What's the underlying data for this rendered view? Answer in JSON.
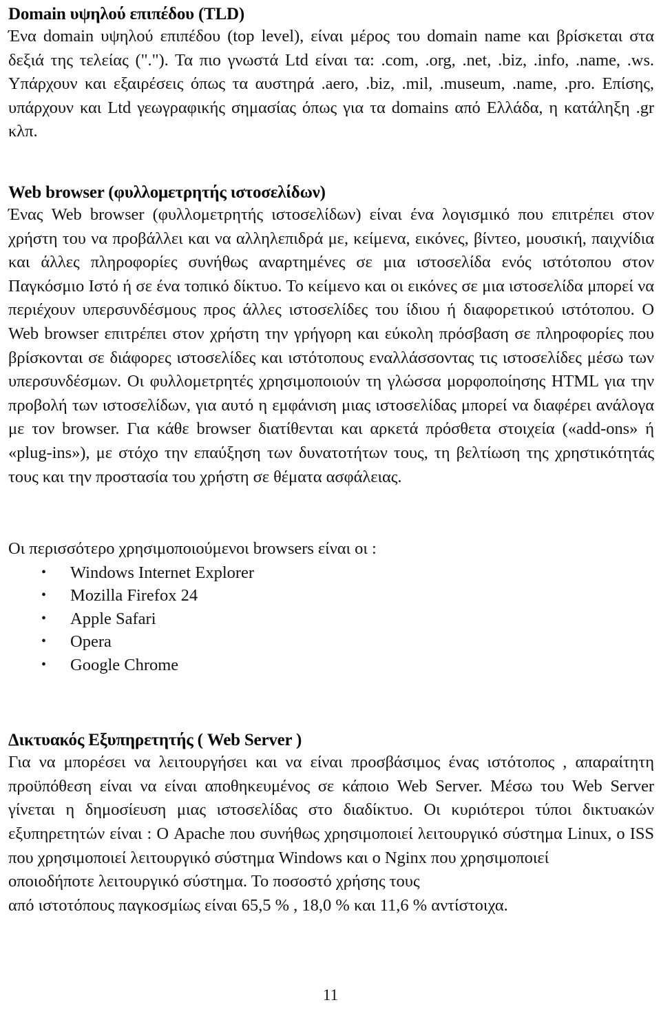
{
  "page": {
    "number": "11",
    "language": "el"
  },
  "sections": {
    "tld": {
      "heading": "Domain υψηλού επιπέδου (TLD)",
      "paragraph": "Ένα domain υψηλού επιπέδου (top level), είναι μέρος του domain name και βρίσκεται στα δεξιά της τελείας (\".\"). Τα πιο γνωστά Ltd είναι τα: .com, .org, .net, .biz, .info, .name, .ws. Υπάρχουν και εξαιρέσεις όπως τα αυστηρά .aero, .biz, .mil, .museum, .name, .pro. Επίσης, υπάρχουν και Ltd γεωγραφικής σημασίας όπως για τα domains από Ελλάδα, η κατάληξη .gr κλπ."
    },
    "browser": {
      "heading": "Web browser (φυλλομετρητής ιστοσελίδων)",
      "paragraph": "Ένας Web browser (φυλλομετρητής ιστοσελίδων) είναι ένα λογισμικό που επιτρέπει στον χρήστη του να προβάλλει και να αλληλεπιδρά με, κείμενα, εικόνες, βίντεο, μουσική, παιχνίδια και άλλες πληροφορίες συνήθως αναρτημένες σε μια ιστοσελίδα ενός ιστότοπου στον Παγκόσμιο Ιστό ή σε ένα τοπικό δίκτυο. Το κείμενο και οι εικόνες σε μια ιστοσελίδα μπορεί να περιέχουν υπερσυνδέσμους προς άλλες ιστοσελίδες του ίδιου ή διαφορετικού ιστότοπου. Ο Web browser επιτρέπει στον χρήστη την γρήγορη και εύκολη πρόσβαση σε πληροφορίες που βρίσκονται σε διάφορες ιστοσελίδες και ιστότοπους εναλλάσσοντας τις ιστοσελίδες μέσω των υπερσυνδέσμων. Οι φυλλομετρητές χρησιμοποιούν τη γλώσσα μορφοποίησης HTML για την προβολή των ιστοσελίδων, για αυτό η εμφάνιση μιας ιστοσελίδας μπορεί να διαφέρει ανάλογα με τον browser. Για κάθε browser διατίθενται και αρκετά πρόσθετα στοιχεία («add-ons» ή «plug-ins»), με στόχο την επαύξηση των δυνατοτήτων τους, τη βελτίωση της χρηστικότητάς τους και την προστασία του χρήστη σε θέματα ασφάλειας."
    },
    "browser_list": {
      "intro": "Οι περισσότερο χρησιμοποιούμενοι browsers είναι οι :",
      "bullet_glyph": "•",
      "items": [
        "Windows Internet Explorer",
        "Mozilla Firefox 24",
        "Apple Safari",
        "Opera",
        "Google Chrome"
      ]
    },
    "server": {
      "heading": "Δικτυακός Εξυπηρετητής ( Web Server )",
      "paragraph": "Για να μπορέσει να λειτουργήσει και να είναι προσβάσιμος ένας ιστότοπος , απαραίτητη προϋπόθεση είναι να είναι αποθηκευμένος σε κάποιο Web Server. Μέσω του Web Server γίνεται η δημοσίευση μιας ιστοσελίδας στο διαδίκτυο. Οι κυριότεροι τύποι δικτυακών εξυπηρετητών είναι : Ο Apache που συνήθως χρησιμοποιεί λειτουργικό σύστημα Linux, ο ISS που χρησιμοποιεί λειτουργικό σύστημα Windows και ο Nginx που χρησιμοποιεί",
      "tail_line_1": "οποιοδήποτε λειτουργικό σύστημα. Το ποσοστό χρήσης τους",
      "tail_line_2": "από ιστοτόπους παγκοσμίως είναι 65,5 % , 18,0 % και 11,6 % αντίστοιχα."
    }
  }
}
